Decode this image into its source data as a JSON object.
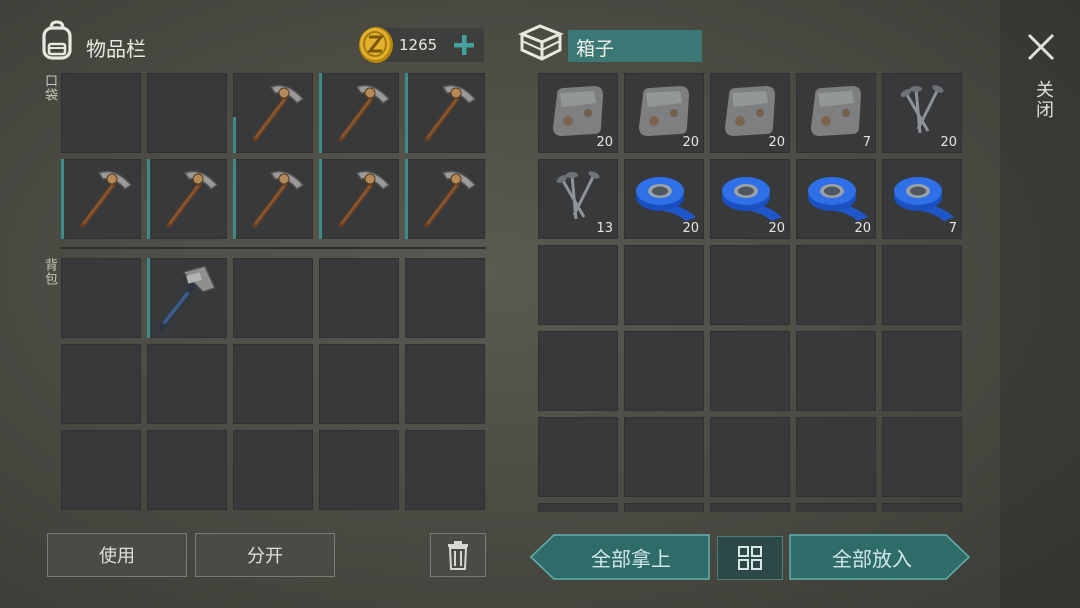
{
  "inventory": {
    "title": "物品栏",
    "currency": "1265",
    "pocket_label": "口袋",
    "backpack_label": "背包",
    "buttons": {
      "use": "使用",
      "split": "分开"
    }
  },
  "container": {
    "name": "箱子",
    "close_label": "关闭",
    "take_all": "全部拿上",
    "put_all": "全部放入"
  },
  "pocket_slots": [
    {
      "item": "",
      "durability": 0
    },
    {
      "item": "",
      "durability": 0
    },
    {
      "item": "pickaxe-icon",
      "durability": 0.45
    },
    {
      "item": "pickaxe-icon",
      "durability": 1
    },
    {
      "item": "pickaxe-icon",
      "durability": 1
    },
    {
      "item": "pickaxe-icon",
      "durability": 1
    },
    {
      "item": "pickaxe-icon",
      "durability": 1
    },
    {
      "item": "pickaxe-icon",
      "durability": 1
    },
    {
      "item": "pickaxe-icon",
      "durability": 1
    },
    {
      "item": "pickaxe-icon",
      "durability": 1
    }
  ],
  "backpack_slots": [
    {
      "item": "",
      "durability": 0
    },
    {
      "item": "hammer-icon",
      "durability": 1
    },
    {
      "item": "",
      "durability": 0
    },
    {
      "item": "",
      "durability": 0
    },
    {
      "item": "",
      "durability": 0
    },
    {
      "item": "",
      "durability": 0
    },
    {
      "item": "",
      "durability": 0
    },
    {
      "item": "",
      "durability": 0
    },
    {
      "item": "",
      "durability": 0
    },
    {
      "item": "",
      "durability": 0
    },
    {
      "item": "",
      "durability": 0
    },
    {
      "item": "",
      "durability": 0
    },
    {
      "item": "",
      "durability": 0
    },
    {
      "item": "",
      "durability": 0
    },
    {
      "item": "",
      "durability": 0
    }
  ],
  "container_slots": [
    {
      "item": "metal-plate-icon",
      "count": "20"
    },
    {
      "item": "metal-plate-icon",
      "count": "20"
    },
    {
      "item": "metal-plate-icon",
      "count": "20"
    },
    {
      "item": "metal-plate-icon",
      "count": "7"
    },
    {
      "item": "nails-icon",
      "count": "20"
    },
    {
      "item": "nails-icon",
      "count": "13"
    },
    {
      "item": "tape-icon",
      "count": "20"
    },
    {
      "item": "tape-icon",
      "count": "20"
    },
    {
      "item": "tape-icon",
      "count": "20"
    },
    {
      "item": "tape-icon",
      "count": "7"
    },
    {
      "item": "",
      "count": ""
    },
    {
      "item": "",
      "count": ""
    },
    {
      "item": "",
      "count": ""
    },
    {
      "item": "",
      "count": ""
    },
    {
      "item": "",
      "count": ""
    },
    {
      "item": "",
      "count": ""
    },
    {
      "item": "",
      "count": ""
    },
    {
      "item": "",
      "count": ""
    },
    {
      "item": "",
      "count": ""
    },
    {
      "item": "",
      "count": ""
    },
    {
      "item": "",
      "count": ""
    },
    {
      "item": "",
      "count": ""
    },
    {
      "item": "",
      "count": ""
    },
    {
      "item": "",
      "count": ""
    },
    {
      "item": "",
      "count": ""
    },
    {
      "item": "",
      "count": ""
    },
    {
      "item": "",
      "count": ""
    },
    {
      "item": "",
      "count": ""
    },
    {
      "item": "",
      "count": ""
    },
    {
      "item": "",
      "count": ""
    }
  ],
  "colors": {
    "accent": "#3e8c8a",
    "slot": "#37393a",
    "panel": "#4a4a43"
  }
}
